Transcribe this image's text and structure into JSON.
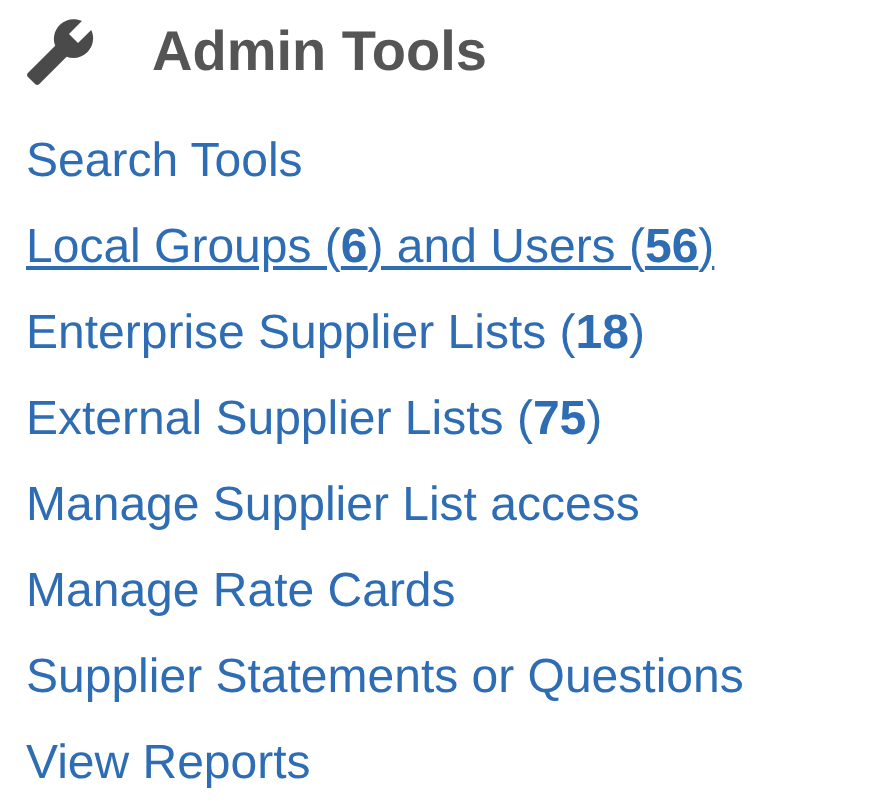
{
  "title": "Admin Tools",
  "links": [
    {
      "text": "Search Tools",
      "hovered": false
    },
    {
      "text": "Local Groups (**6**) and Users (**56**)",
      "hovered": true
    },
    {
      "text": "Enterprise Supplier Lists (**18**)",
      "hovered": false
    },
    {
      "text": "External Supplier Lists (**75**)",
      "hovered": false
    },
    {
      "text": "Manage Supplier List access",
      "hovered": false
    },
    {
      "text": "Manage Rate Cards",
      "hovered": false
    },
    {
      "text": "Supplier Statements or Questions",
      "hovered": false
    },
    {
      "text": "View Reports",
      "hovered": false
    }
  ]
}
